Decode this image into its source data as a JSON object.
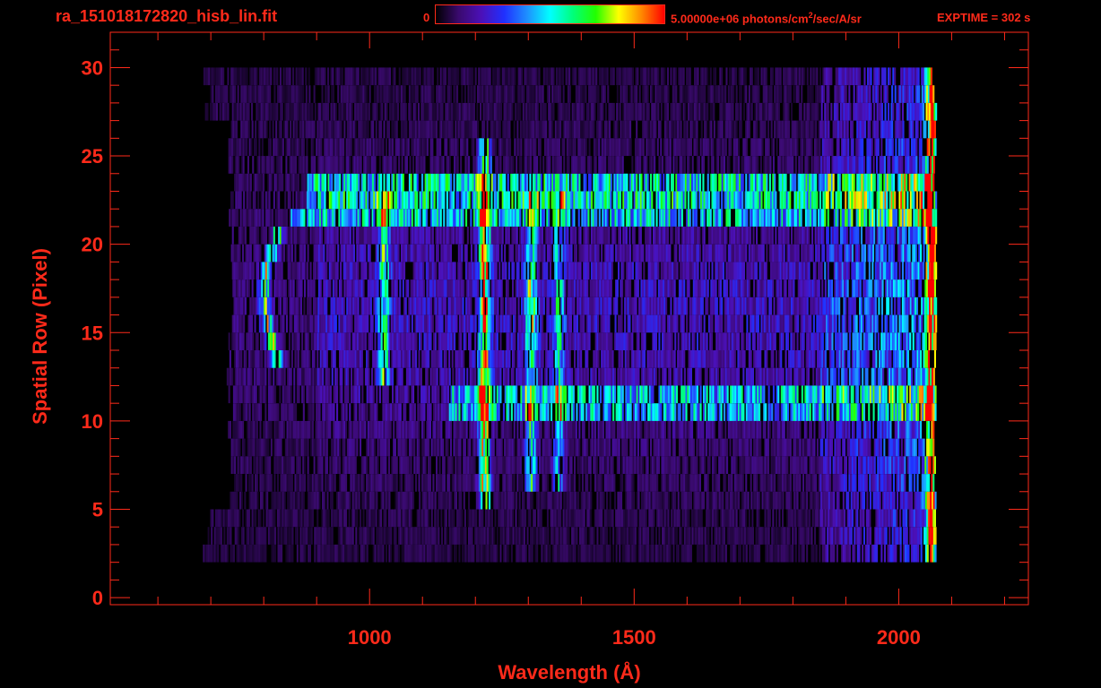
{
  "header": {
    "filename": "ra_151018172820_hisb_lin.fit",
    "colorbar_min": "0",
    "colorbar_max_value": "5.00000e+06 photons/cm",
    "colorbar_max_sup": "2",
    "colorbar_max_unit": "/sec/A/sr",
    "exptime": "EXPTIME = 302 s"
  },
  "colors": {
    "axis": "#ff2a1a",
    "background": "#000000",
    "colormap": [
      "#000000",
      "#3a0a6e",
      "#4b10b8",
      "#2030ff",
      "#1e90ff",
      "#00ffff",
      "#00ff7a",
      "#22ff00",
      "#ffff00",
      "#ff8800",
      "#ff0000"
    ]
  },
  "chart_data": {
    "type": "heatmap",
    "xlabel": "Wavelength (Å)",
    "ylabel": "Spatial Row (Pixel)",
    "xlim": [
      510,
      2245
    ],
    "ylim": [
      -0.4,
      32
    ],
    "x_ticks": [
      1000,
      1500,
      2000
    ],
    "y_ticks": [
      0,
      5,
      10,
      15,
      20,
      25,
      30
    ],
    "x_minor_step": 100,
    "y_minor_step": 1,
    "data_extent_x": [
      685,
      2070
    ],
    "data_extent_y": [
      2,
      30
    ],
    "color_scale": [
      0,
      5000000
    ],
    "grid": false,
    "features": [
      {
        "label": "emission-line",
        "x": 1216,
        "y_range": [
          5,
          25
        ],
        "intensity": 0.65
      },
      {
        "label": "emission-line",
        "x": 1304,
        "y_range": [
          6,
          22
        ],
        "intensity": 0.45
      },
      {
        "label": "emission-line",
        "x": 1026,
        "y_range": [
          12,
          22
        ],
        "intensity": 0.4
      },
      {
        "label": "emission-line",
        "x": 1356,
        "y_range": [
          6,
          22
        ],
        "intensity": 0.32
      },
      {
        "label": "emission-line",
        "x": 2060,
        "y_range": [
          2,
          30
        ],
        "intensity": 0.7
      },
      {
        "label": "horizontal-band",
        "y_range": [
          22,
          24
        ],
        "x_range": [
          880,
          2060
        ],
        "intensity": 0.55
      },
      {
        "label": "horizontal-band",
        "y_range": [
          21,
          22
        ],
        "x_range": [
          850,
          2060
        ],
        "intensity": 0.45
      },
      {
        "label": "horizontal-band",
        "y_range": [
          10,
          12
        ],
        "x_range": [
          1150,
          2060
        ],
        "intensity": 0.4
      },
      {
        "label": "arc",
        "x_range": [
          800,
          850
        ],
        "y_range": [
          13,
          20
        ],
        "intensity": 0.55
      }
    ]
  }
}
